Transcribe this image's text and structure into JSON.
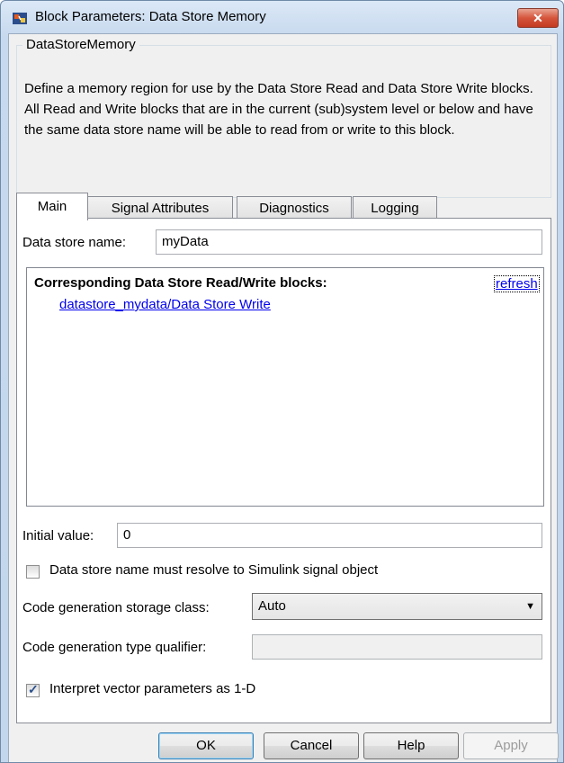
{
  "window": {
    "title": "Block Parameters: Data Store Memory",
    "close_glyph": "✕"
  },
  "group": {
    "title": "DataStoreMemory",
    "description": "Define a memory region for use by the Data Store Read and Data Store Write blocks. All Read and Write blocks that are in the current (sub)system level or below and have the same data store name will be able to read from or write to this block."
  },
  "tabs": [
    {
      "label": "Main",
      "active": true
    },
    {
      "label": "Signal Attributes",
      "active": false
    },
    {
      "label": "Diagnostics",
      "active": false
    },
    {
      "label": "Logging",
      "active": false
    }
  ],
  "main": {
    "data_store_name_label": "Data store name:",
    "data_store_name_value": "myData",
    "blocks_heading": "Corresponding Data Store Read/Write blocks:",
    "refresh_label": "refresh",
    "block_links": [
      "datastore_mydata/Data Store Write"
    ],
    "initial_value_label": "Initial value:",
    "initial_value": "0",
    "resolve_checkbox_label": "Data store name must resolve to Simulink signal object",
    "resolve_checked": false,
    "storage_class_label": "Code generation storage class:",
    "storage_class_value": "Auto",
    "type_qualifier_label": "Code generation type qualifier:",
    "type_qualifier_value": "",
    "interpret_checkbox_label": "Interpret vector parameters as 1-D",
    "interpret_checked": true
  },
  "buttons": {
    "ok": "OK",
    "cancel": "Cancel",
    "help": "Help",
    "apply": "Apply"
  },
  "colors": {
    "link": "#0000ee",
    "close_button": "#c9452d",
    "window_frame": "#c2d6ec"
  },
  "icons": {
    "app": "simulink-block-icon",
    "dropdown": "chevron-down-icon",
    "check": "checkmark-icon"
  }
}
